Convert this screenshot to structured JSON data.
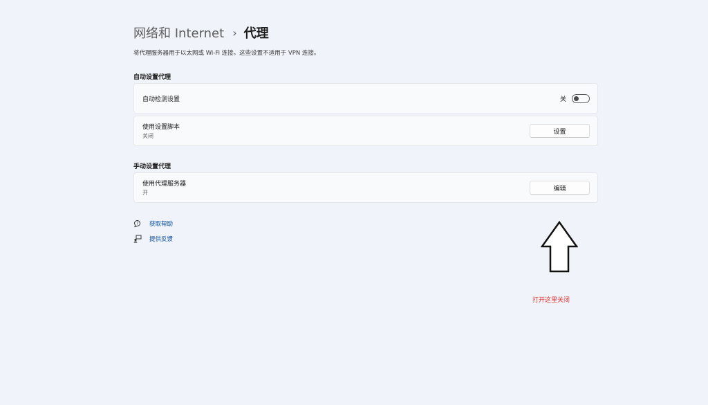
{
  "header": {
    "breadcrumb_parent": "网络和 Internet",
    "breadcrumb_separator": "›",
    "breadcrumb_current": "代理"
  },
  "description": "将代理服务器用于以太网或 Wi-Fi 连接。这些设置不适用于 VPN 连接。",
  "auto_section": {
    "title": "自动设置代理",
    "auto_detect": {
      "label": "自动检测设置",
      "toggle_state_label": "关",
      "toggle_on": false
    },
    "setup_script": {
      "label": "使用设置脚本",
      "status": "关闭",
      "button_label": "设置"
    }
  },
  "manual_section": {
    "title": "手动设置代理",
    "proxy_server": {
      "label": "使用代理服务器",
      "status": "开",
      "button_label": "编辑"
    }
  },
  "links": {
    "help_label": "获取帮助",
    "help_icon": "help-icon",
    "feedback_label": "提供反馈",
    "feedback_icon": "feedback-icon"
  },
  "annotation": {
    "arrow_icon": "up-arrow-icon",
    "text": "打开这里关闭",
    "color": "#e0322f"
  },
  "colors": {
    "link": "#0a4fa3",
    "background": "#f0f3f9",
    "card": "#f9fafc"
  }
}
